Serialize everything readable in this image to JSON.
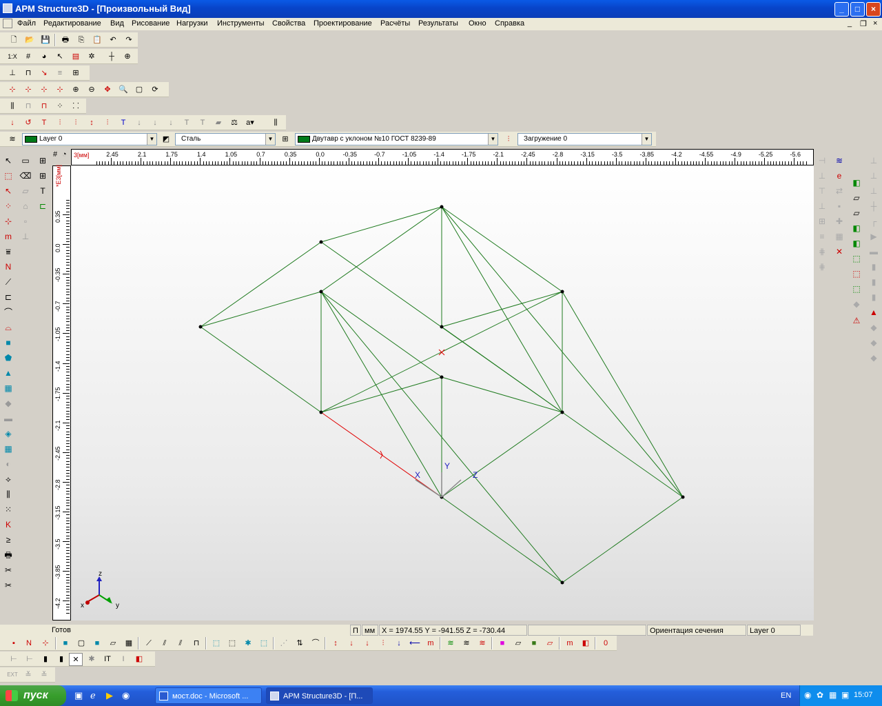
{
  "window": {
    "title": "APM Structure3D - [Произвольный Вид]"
  },
  "menu": {
    "items": [
      "Файл",
      "Редактирование",
      "Вид",
      "Рисование",
      "Нагрузки",
      "Инструменты",
      "Свойства",
      "Проектирование",
      "Расчёты",
      "Результаты",
      "Окно",
      "Справка"
    ]
  },
  "props": {
    "layer": "Layer 0",
    "material": "Сталь",
    "section": "Двутавр с уклоном  №10 ГОСТ 8239-89",
    "loading": "Загружение 0"
  },
  "ruler": {
    "unit_h": "3[мм]",
    "unit_v": "*E3[мм]",
    "h_ticks": [
      "2.45",
      "2.1",
      "1.75",
      "1.4",
      "1.05",
      "0.7",
      "0.35",
      "0.0",
      "-0.35",
      "-0.7",
      "-1.05",
      "-1.4",
      "-1.75",
      "-2.1",
      "-2.45",
      "-2.8",
      "-3.15",
      "-3.5",
      "-3.85",
      "-4.2",
      "-4.55",
      "-4.9",
      "-5.25",
      "-5.6"
    ],
    "v_ticks": [
      "0.35",
      "0.0",
      "-0.35",
      "-0.7",
      "-1.05",
      "-1.4",
      "-1.75",
      "-2.1",
      "-2.45",
      "-2.8",
      "-3.15",
      "-3.5",
      "-3.85",
      "-4.2"
    ]
  },
  "axes": {
    "local_x": "X",
    "local_y": "Y",
    "local_z": "Z",
    "global_x": "x",
    "global_y": "y",
    "global_z": "z"
  },
  "status": {
    "ready": "Готов",
    "p": "П",
    "unit": "мм",
    "coords": "X = 1974.55 Y = -941.55 Z = -730.44",
    "orientation": "Ориентация сечения",
    "layer": "Layer 0"
  },
  "taskbar": {
    "start": "пуск",
    "task1": "мост.doc - Microsoft ...",
    "task2": "APM Structure3D - [П...",
    "lang": "EN",
    "clock": "15:07"
  },
  "colors": {
    "member": "#1e7a1e",
    "selected": "#e00000",
    "titlebar": "#0a5ae6"
  }
}
